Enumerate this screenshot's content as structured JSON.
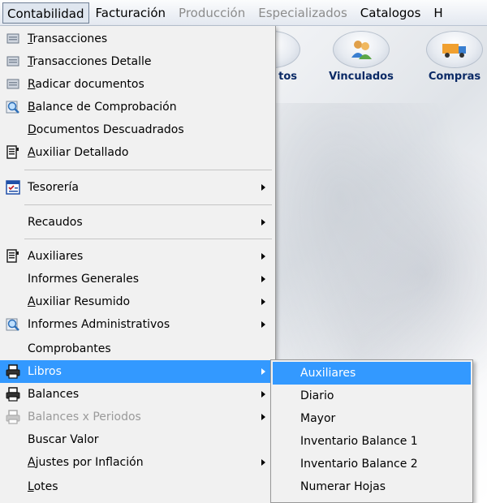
{
  "menubar": {
    "items": [
      {
        "label": "Contabilidad"
      },
      {
        "label": "Facturación"
      },
      {
        "label": "Producción"
      },
      {
        "label": "Especializados"
      },
      {
        "label": "Catalogos"
      },
      {
        "label": "H"
      }
    ]
  },
  "toolbar": {
    "partial_label": "tos",
    "vinculados_label": "Vinculados",
    "compras_label": "Compras"
  },
  "menu": {
    "transacciones": {
      "pre": "",
      "key": "T",
      "post": "ransacciones"
    },
    "transacciones_detalle": {
      "pre": "",
      "key": "T",
      "post": "ransacciones Detalle"
    },
    "radicar_documentos": {
      "pre": "",
      "key": "R",
      "post": "adicar documentos"
    },
    "balance_comprobacion": {
      "pre": "",
      "key": "B",
      "post": "alance de Comprobación"
    },
    "documentos_descuadrados": {
      "pre": "",
      "key": "D",
      "post": "ocumentos Descuadrados"
    },
    "auxiliar_detallado": {
      "pre": "",
      "key": "A",
      "post": "uxiliar Detallado"
    },
    "tesoreria": {
      "label": "Tesorería"
    },
    "recaudos": {
      "label": "Recaudos"
    },
    "auxiliares": {
      "label": "Auxiliares"
    },
    "informes_generales": {
      "label": "Informes Generales"
    },
    "auxiliar_resumido": {
      "pre": "",
      "key": "A",
      "post": "uxiliar Resumido"
    },
    "informes_administrativos": {
      "label": "Informes Administrativos"
    },
    "comprobantes": {
      "label": "Comprobantes"
    },
    "libros": {
      "label": "Libros"
    },
    "balances": {
      "label": "Balances"
    },
    "balances_periodos": {
      "label": "Balances x Periodos"
    },
    "buscar_valor": {
      "label": "Buscar Valor"
    },
    "ajustes_inflacion": {
      "pre": "",
      "key": "A",
      "post": "justes por Inflación"
    },
    "lotes": {
      "pre": "",
      "key": "L",
      "post": "otes"
    }
  },
  "submenu": {
    "items": [
      {
        "label": "Auxiliares"
      },
      {
        "label": "Diario"
      },
      {
        "label": "Mayor"
      },
      {
        "label": "Inventario Balance 1"
      },
      {
        "label": "Inventario Balance 2"
      },
      {
        "label": "Numerar Hojas"
      }
    ]
  },
  "colors": {
    "selection": "#3399ff",
    "menu_bg": "#f1f1f1",
    "disabled_text": "#9a9a9a"
  }
}
